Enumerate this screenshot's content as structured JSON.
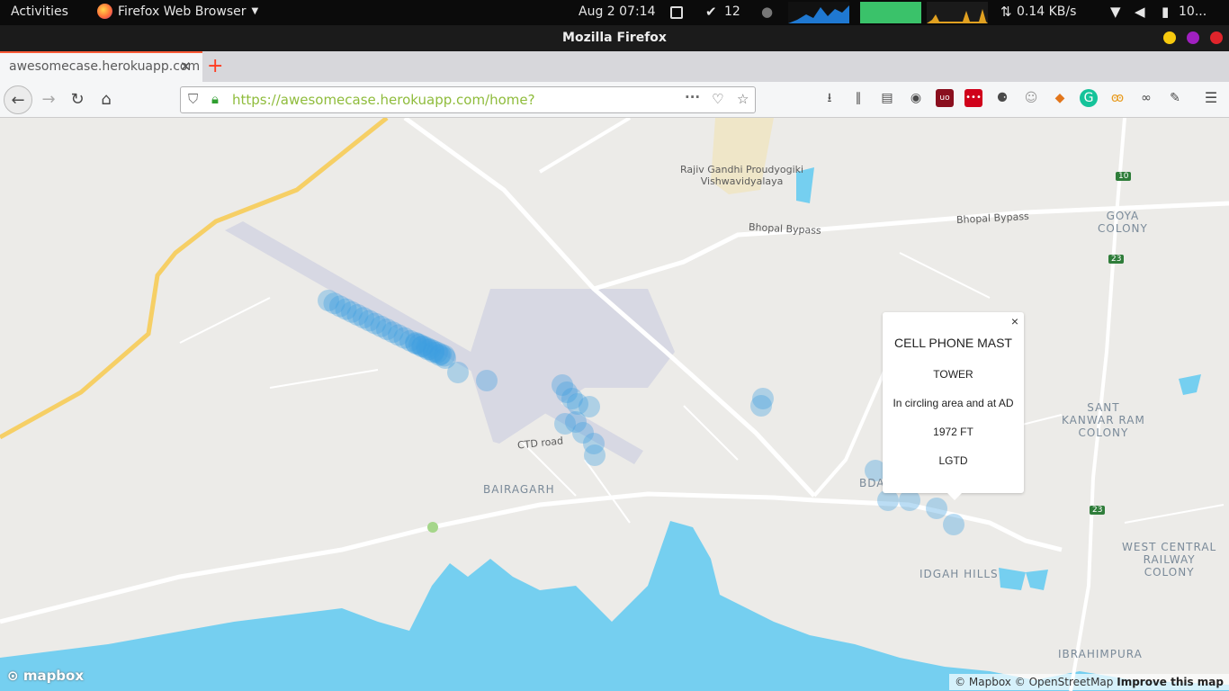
{
  "topbar": {
    "activities": "Activities",
    "app_name": "Firefox Web Browser",
    "clock": "Aug 2  07:14",
    "task_count": "12",
    "net_speed": "0.14 KB/s",
    "battery": "10..."
  },
  "window": {
    "title": "Mozilla Firefox",
    "buttons": {
      "minimize_color": "#f6c90e",
      "maximize_color": "#a020c0",
      "close_color": "#e0242b"
    }
  },
  "tab": {
    "title": "awesomecase.herokuapp.com"
  },
  "navbar": {
    "url": "https://awesomecase.herokuapp.com/home?"
  },
  "map": {
    "labels": {
      "university": "Rajiv Gandhi Proudyogiki\nVishwavidyalaya",
      "bypass1": "Bhopal Bypass",
      "bypass2": "Bhopal Bypass",
      "ctd": "CTD road",
      "bairagarh": "BAIRAGARH",
      "goya": "GOYA\nCOLONY",
      "sant": "SANT\nKANWAR RAM\nCOLONY",
      "idgah": "IDGAH HILLS",
      "west_central": "WEST CENTRAL\nRAILWAY\nCOLONY",
      "ibrahimpura": "IBRAHIMPURA",
      "bda": "BDA",
      "nh10": "10",
      "nh23a": "23",
      "nh23b": "23"
    },
    "colors": {
      "water": "#75cff0",
      "marker": "#3d9fe0",
      "road_major": "#f6cf65",
      "airport": "#d7d8e3"
    }
  },
  "popup": {
    "close": "×",
    "title": "CELL PHONE MAST",
    "type": "TOWER",
    "location": "In circling area and at AD",
    "elevation": "1972 FT",
    "lighting": "LGTD"
  },
  "attribution": {
    "logo": "mapbox",
    "mapbox": "© Mapbox",
    "osm": "© OpenStreetMap",
    "improve": "Improve this map"
  }
}
